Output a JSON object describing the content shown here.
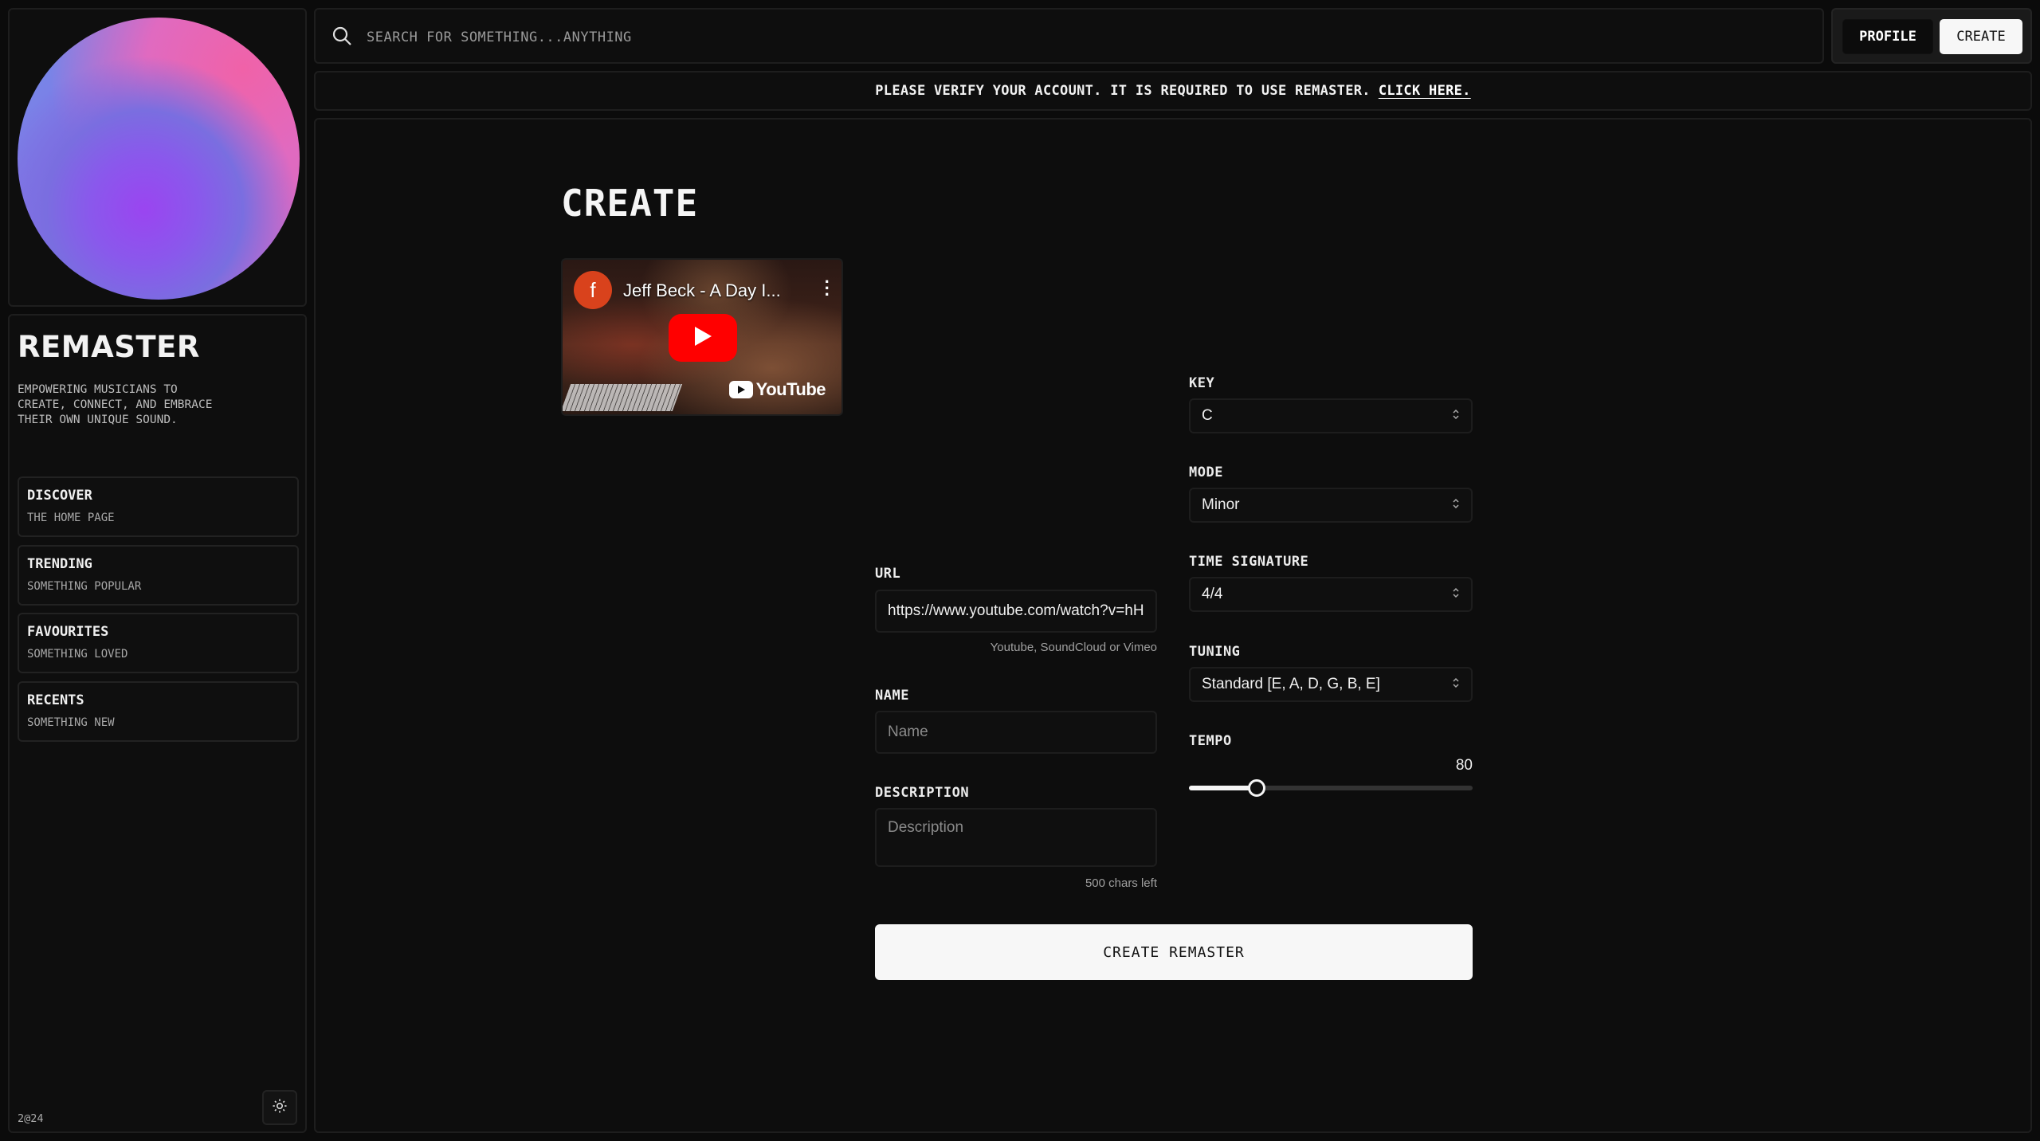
{
  "sidebar": {
    "logo": "REMASTER",
    "tagline": "EMPOWERING MUSICIANS TO\nCREATE, CONNECT, AND EMBRACE\nTHEIR OWN UNIQUE SOUND.",
    "nav": [
      {
        "title": "DISCOVER",
        "subtitle": "THE HOME PAGE"
      },
      {
        "title": "TRENDING",
        "subtitle": "SOMETHING POPULAR"
      },
      {
        "title": "FAVOURITES",
        "subtitle": "SOMETHING LOVED"
      },
      {
        "title": "RECENTS",
        "subtitle": "SOMETHING NEW"
      }
    ],
    "year": "2@24"
  },
  "search": {
    "placeholder": "SEARCH FOR SOMETHING...ANYTHING"
  },
  "top_buttons": {
    "profile": "PROFILE",
    "create": "CREATE"
  },
  "banner": {
    "text": "PLEASE VERIFY YOUR ACCOUNT. IT IS REQUIRED TO USE REMASTER.",
    "link": "CLICK HERE."
  },
  "form": {
    "title": "CREATE",
    "video": {
      "channel_initial": "f",
      "title": "Jeff Beck - A Day I...",
      "brand": "YouTube"
    },
    "url": {
      "label": "URL",
      "value": "https://www.youtube.com/watch?v=hH",
      "hint": "Youtube, SoundCloud or Vimeo"
    },
    "name": {
      "label": "NAME",
      "placeholder": "Name"
    },
    "description": {
      "label": "DESCRIPTION",
      "placeholder": "Description",
      "hint": "500 chars left"
    },
    "key": {
      "label": "KEY",
      "value": "C"
    },
    "mode": {
      "label": "MODE",
      "value": "Minor"
    },
    "time_signature": {
      "label": "TIME SIGNATURE",
      "value": "4/4"
    },
    "tuning": {
      "label": "TUNING",
      "value": "Standard [E, A, D, G, B, E]"
    },
    "tempo": {
      "label": "TEMPO",
      "value": "80",
      "slider_fraction": 0.24
    },
    "submit": "CREATE REMASTER"
  },
  "colors": {
    "background": "#0b0b0b",
    "panel": "#0e0e0e",
    "accent": "#f7f7f7",
    "youtube_red": "#ff0000"
  }
}
